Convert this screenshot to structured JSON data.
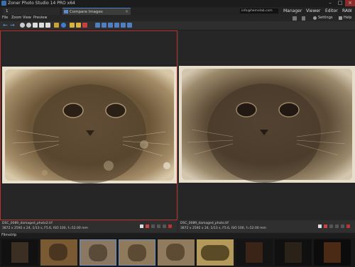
{
  "app": {
    "title": "Zoner Photo Studio 14 PRO x64"
  },
  "tabs": [
    {
      "label": "1"
    },
    {
      "label": "Compare Images"
    }
  ],
  "account": {
    "email": "info@hemelab.com"
  },
  "modes": [
    "Manager",
    "Viewer",
    "Editor",
    "RAW"
  ],
  "menu": [
    "File",
    "Zoom",
    "View",
    "Preview"
  ],
  "right_menu": {
    "settings": "Settings",
    "help": "Help"
  },
  "toolbar": {
    "icons": [
      "back-arrow-icon",
      "forward-arrow-icon",
      "zoom-in-icon",
      "zoom-out-icon",
      "fit-icon",
      "actual-size-icon",
      "grid-icon",
      "info-icon",
      "folder-icon",
      "rotate-icon",
      "flag-icon",
      "layout-1-icon",
      "layout-2-icon",
      "layout-3-icon",
      "layout-4-icon",
      "layout-5-icon",
      "layout-6-icon"
    ]
  },
  "panes": [
    {
      "filename": "DSC_0089_damaged_photo2.tif",
      "details": "3872 x 2592 x 24, 1/13 s, F5.6, ISO 100, f=52.00 mm"
    },
    {
      "filename": "DSC_0089_damaged_photo.tif",
      "details": "3872 x 2592 x 24, 1/13 s, F5.6, ISO 100, f=52.00 mm"
    }
  ],
  "filmstrip": {
    "label": "Filmstrip",
    "thumb_count": 9
  },
  "colors": {
    "accent_blue": "#4a7dbd",
    "selection_red": "#b8322f",
    "sepia": "#8a7355"
  }
}
